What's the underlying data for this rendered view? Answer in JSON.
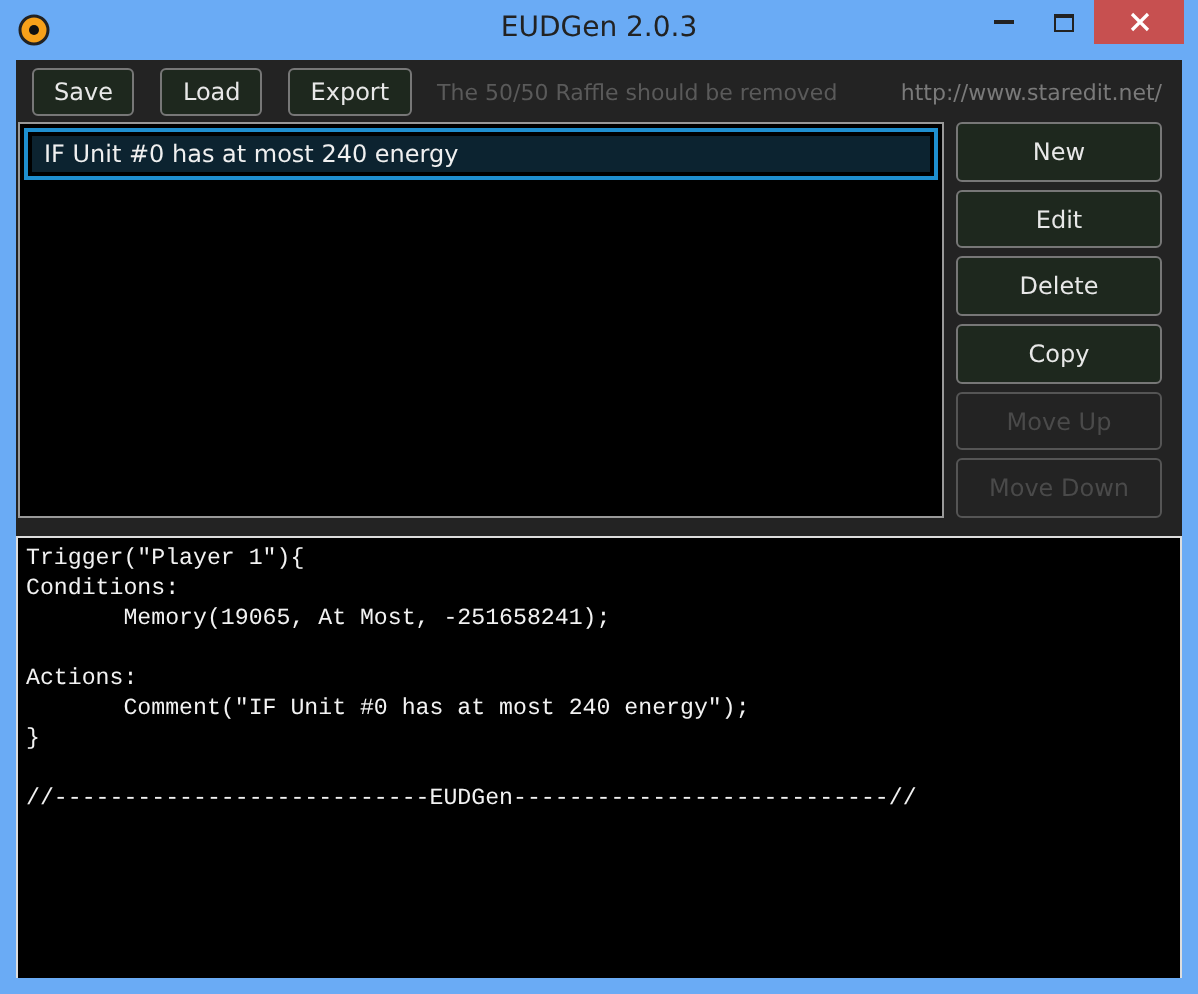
{
  "window": {
    "title": "EUDGen 2.0.3"
  },
  "toolbar": {
    "buttons": [
      "Save",
      "Load",
      "Export"
    ],
    "notice": "The 50/50 Raffle should be removed",
    "link": "http://www.staredit.net/"
  },
  "triggers": [
    {
      "label": "IF Unit #0 has at most 240 energy",
      "selected": true
    }
  ],
  "actions": [
    {
      "label": "New",
      "disabled": false
    },
    {
      "label": "Edit",
      "disabled": false
    },
    {
      "label": "Delete",
      "disabled": false
    },
    {
      "label": "Copy",
      "disabled": false
    },
    {
      "label": "Move Up",
      "disabled": true
    },
    {
      "label": "Move Down",
      "disabled": true
    }
  ],
  "code": {
    "text": "Trigger(\"Player 1\"){\nConditions:\n\tMemory(19065, At Most, -251658241);\n\nActions:\n\tComment(\"IF Unit #0 has at most 240 energy\");\n}\n\n//---------------------------EUDGen---------------------------//"
  }
}
